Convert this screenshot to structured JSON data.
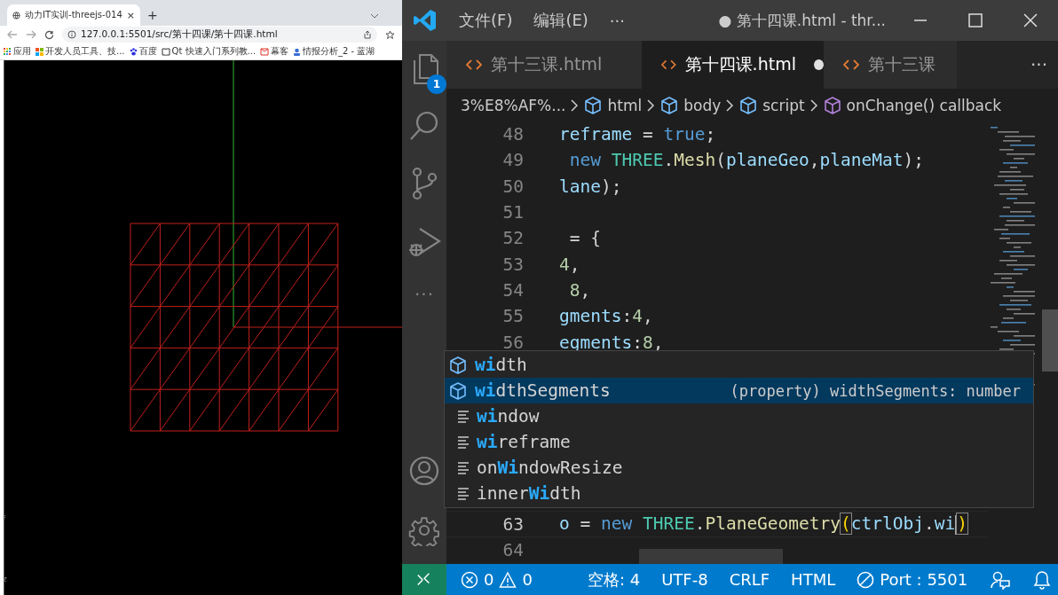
{
  "browser": {
    "tab": {
      "title": "动力IT实训-threejs-014",
      "close": "×",
      "new_tab": "+"
    },
    "address": {
      "url": "127.0.0.1:5501/src/第十四课/第十四课.html"
    },
    "bookmarks": [
      {
        "label": "应用",
        "kind": "apps"
      },
      {
        "label": "开发人员工具、技...",
        "kind": "windows"
      },
      {
        "label": "百度",
        "kind": "paw"
      },
      {
        "label": "Qt 快速入门系列教...",
        "kind": "book"
      },
      {
        "label": "幕客",
        "kind": "mail"
      },
      {
        "label": "情报分析_2 - 蓝湖",
        "kind": "person"
      }
    ],
    "canvas": {
      "edge_labels": [
        "F",
        "Z"
      ]
    }
  },
  "editor": {
    "window": {
      "title": "● 第十四课.html - thr..."
    },
    "menu": [
      "文件(F)",
      "编辑(E)",
      "···"
    ],
    "activity_bar": {
      "explorer_badge": "1",
      "more": "···"
    },
    "tabs": [
      {
        "label": "第十三课.html",
        "selected": false,
        "modified": false
      },
      {
        "label": "第十四课.html",
        "selected": true,
        "modified": true
      },
      {
        "label": "第十三课",
        "selected": false,
        "modified": false
      }
    ],
    "tabs_more": "···",
    "breadcrumb": [
      {
        "label": "3%E8%AF%...",
        "kind": "path"
      },
      {
        "label": "html",
        "kind": "element"
      },
      {
        "label": "body",
        "kind": "element"
      },
      {
        "label": "script",
        "kind": "element"
      },
      {
        "label": "onChange() callback",
        "kind": "function"
      }
    ],
    "code_top": [
      {
        "number": "48",
        "tokens": [
          {
            "text": "reframe",
            "kind": "var"
          },
          {
            "text": " = ",
            "kind": "plain"
          },
          {
            "text": "true",
            "kind": "keyword"
          },
          {
            "text": ";",
            "kind": "plain"
          }
        ]
      },
      {
        "number": "49",
        "tokens": [
          {
            "text": " new",
            "kind": "keyword"
          },
          {
            "text": " THREE",
            "kind": "class"
          },
          {
            "text": ".",
            "kind": "plain"
          },
          {
            "text": "Mesh",
            "kind": "func"
          },
          {
            "text": "(",
            "kind": "plain"
          },
          {
            "text": "planeGeo",
            "kind": "var"
          },
          {
            "text": ",",
            "kind": "plain"
          },
          {
            "text": "planeMat",
            "kind": "var"
          },
          {
            "text": ");",
            "kind": "plain"
          }
        ]
      },
      {
        "number": "50",
        "tokens": [
          {
            "text": "lane",
            "kind": "var"
          },
          {
            "text": ");",
            "kind": "plain"
          }
        ]
      },
      {
        "number": "51"
      },
      {
        "number": "52",
        "tokens": [
          {
            "text": " = {",
            "kind": "plain"
          }
        ]
      },
      {
        "number": "53",
        "tokens": [
          {
            "text": "4",
            "kind": "number"
          },
          {
            "text": ",",
            "kind": "plain"
          }
        ]
      },
      {
        "number": "54",
        "tokens": [
          {
            "text": " 8",
            "kind": "number"
          },
          {
            "text": ",",
            "kind": "plain"
          }
        ]
      },
      {
        "number": "55",
        "tokens": [
          {
            "text": "gments",
            "kind": "var"
          },
          {
            "text": ":",
            "kind": "plain"
          },
          {
            "text": "4",
            "kind": "number"
          },
          {
            "text": ",",
            "kind": "plain"
          }
        ]
      },
      {
        "number": "56",
        "tokens": [
          {
            "text": "egments",
            "kind": "var"
          },
          {
            "text": ":",
            "kind": "plain"
          },
          {
            "text": "8",
            "kind": "number"
          },
          {
            "text": ",",
            "kind": "plain"
          }
        ]
      }
    ],
    "code_bottom": [
      {
        "number": "63",
        "current": true,
        "tokens": [
          {
            "text": "o",
            "kind": "var"
          },
          {
            "text": " = ",
            "kind": "plain"
          },
          {
            "text": "new",
            "kind": "keyword"
          },
          {
            "text": " THREE",
            "kind": "class"
          },
          {
            "text": ".",
            "kind": "plain"
          },
          {
            "text": "PlaneGeometry",
            "kind": "func"
          },
          {
            "text": "(",
            "kind": "bracket"
          },
          {
            "text": "ctrlObj",
            "kind": "var"
          },
          {
            "text": ".",
            "kind": "plain"
          },
          {
            "text": "wi",
            "kind": "var"
          },
          {
            "text": ")",
            "kind": "bracket"
          }
        ]
      },
      {
        "number": "64",
        "current": false
      }
    ],
    "suggestions": [
      {
        "kind": "property",
        "selected": false,
        "parts": [
          {
            "text": "wi",
            "match": true
          },
          {
            "text": "dth",
            "match": false
          }
        ]
      },
      {
        "kind": "property",
        "selected": true,
        "parts": [
          {
            "text": "wi",
            "match": true
          },
          {
            "text": "dthSegments",
            "match": false
          }
        ],
        "detail": "(property) widthSegments: number"
      },
      {
        "kind": "text",
        "selected": false,
        "parts": [
          {
            "text": "wi",
            "match": true
          },
          {
            "text": "ndow",
            "match": false
          }
        ]
      },
      {
        "kind": "text",
        "selected": false,
        "parts": [
          {
            "text": "wi",
            "match": true
          },
          {
            "text": "reframe",
            "match": false
          }
        ]
      },
      {
        "kind": "text",
        "selected": false,
        "parts": [
          {
            "text": "on",
            "match": false
          },
          {
            "text": "Wi",
            "match": true
          },
          {
            "text": "ndowResize",
            "match": false
          }
        ]
      },
      {
        "kind": "text",
        "selected": false,
        "parts": [
          {
            "text": "inner",
            "match": false
          },
          {
            "text": "Wi",
            "match": true
          },
          {
            "text": "dth",
            "match": false
          }
        ]
      }
    ],
    "status_bar": {
      "errors": "0",
      "warnings": "0",
      "indent": "空格: 4",
      "encoding": "UTF-8",
      "eol": "CRLF",
      "language": "HTML",
      "port": "Port : 5501"
    }
  }
}
